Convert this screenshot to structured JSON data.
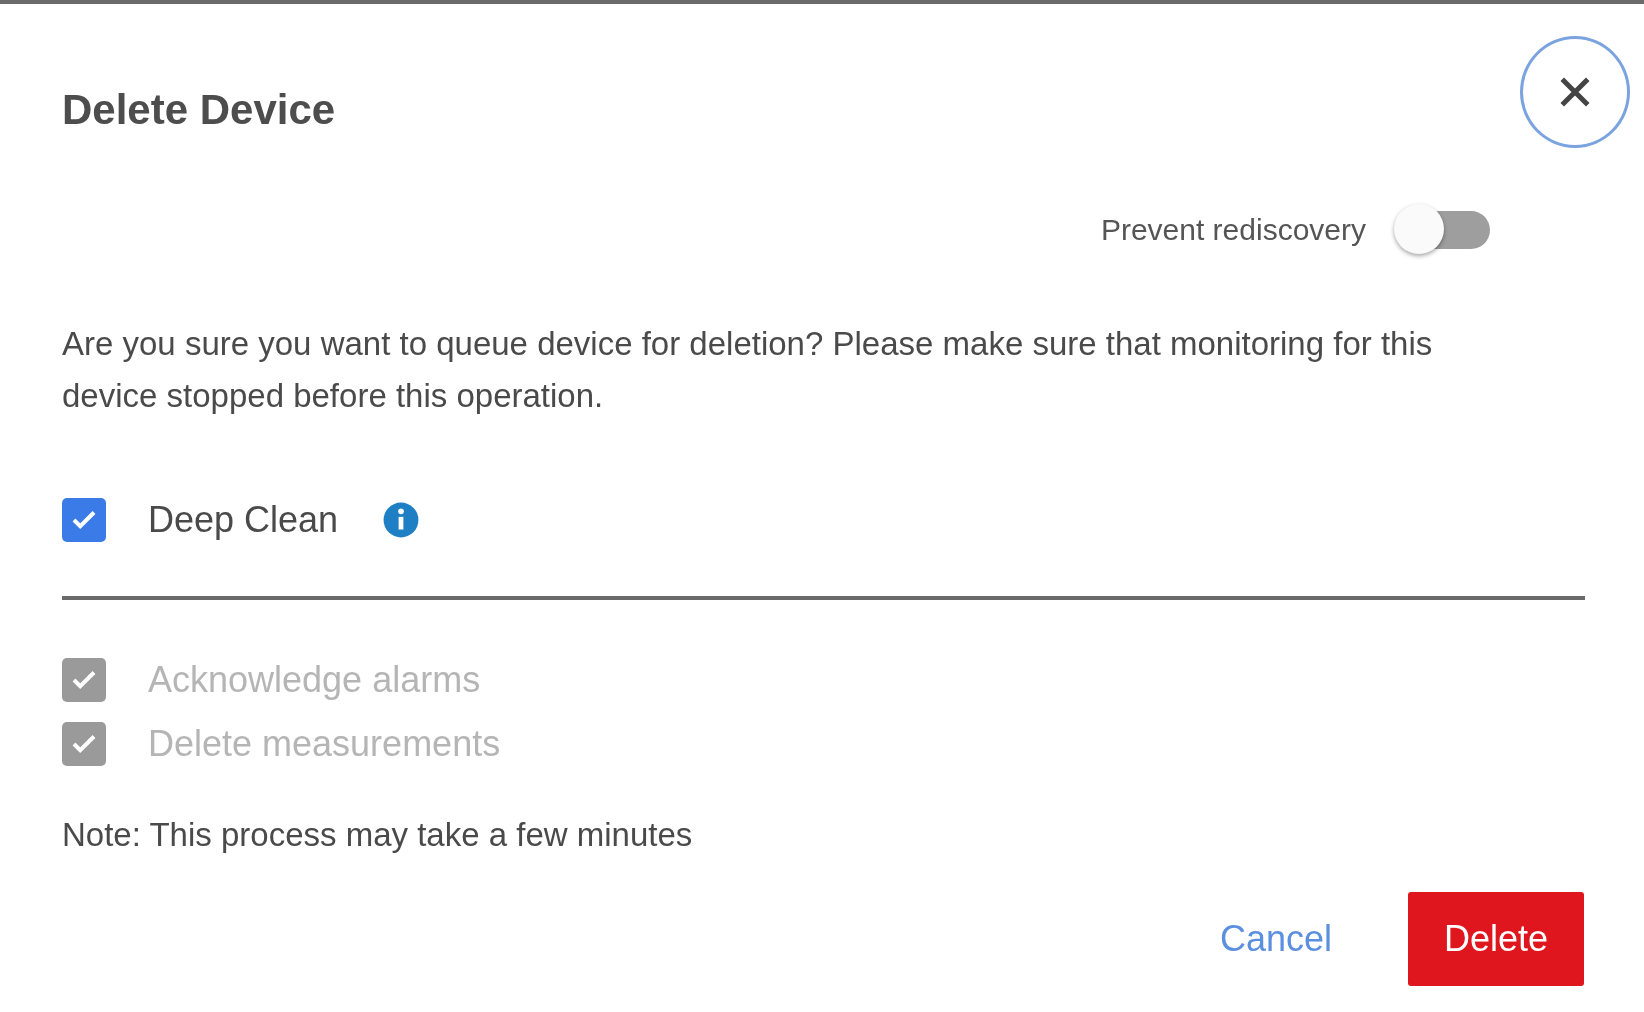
{
  "dialog": {
    "title": "Delete Device"
  },
  "prevent_rediscovery": {
    "label": "Prevent rediscovery",
    "on": false
  },
  "message": "Are you sure you want to queue device for deletion? Please make sure that monitoring for this device stopped before this operation.",
  "deep_clean": {
    "label": "Deep Clean",
    "checked": true
  },
  "options": [
    {
      "label": "Acknowledge alarms",
      "checked": true,
      "disabled": true
    },
    {
      "label": "Delete measurements",
      "checked": true,
      "disabled": true
    }
  ],
  "note": "Note: This process may take a few minutes",
  "buttons": [
    {
      "label": "Cancel",
      "kind": "text"
    },
    {
      "label": "Delete",
      "kind": "danger"
    }
  ]
}
